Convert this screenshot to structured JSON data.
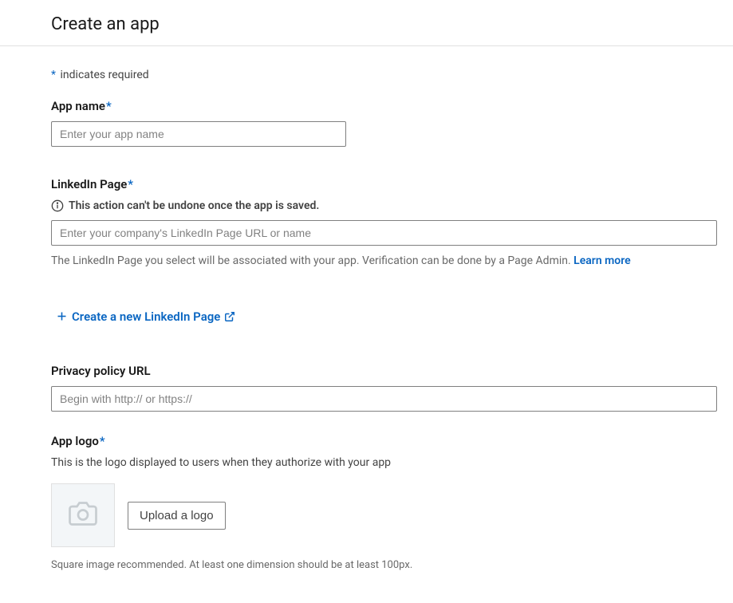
{
  "header": {
    "title": "Create an app"
  },
  "form": {
    "required_note": "indicates required",
    "app_name": {
      "label": "App name",
      "placeholder": "Enter your app name"
    },
    "linkedin_page": {
      "label": "LinkedIn Page",
      "warning": "This action can't be undone once the app is saved.",
      "placeholder": "Enter your company's LinkedIn Page URL or name",
      "help": "The LinkedIn Page you select will be associated with your app. Verification can be done by a Page Admin. ",
      "learn_more": "Learn more",
      "create_link": "Create a new LinkedIn Page"
    },
    "privacy_policy": {
      "label": "Privacy policy URL",
      "placeholder": "Begin with http:// or https://"
    },
    "app_logo": {
      "label": "App logo",
      "description": "This is the logo displayed to users when they authorize with your app",
      "upload_button": "Upload a logo",
      "hint": "Square image recommended. At least one dimension should be at least 100px."
    }
  }
}
